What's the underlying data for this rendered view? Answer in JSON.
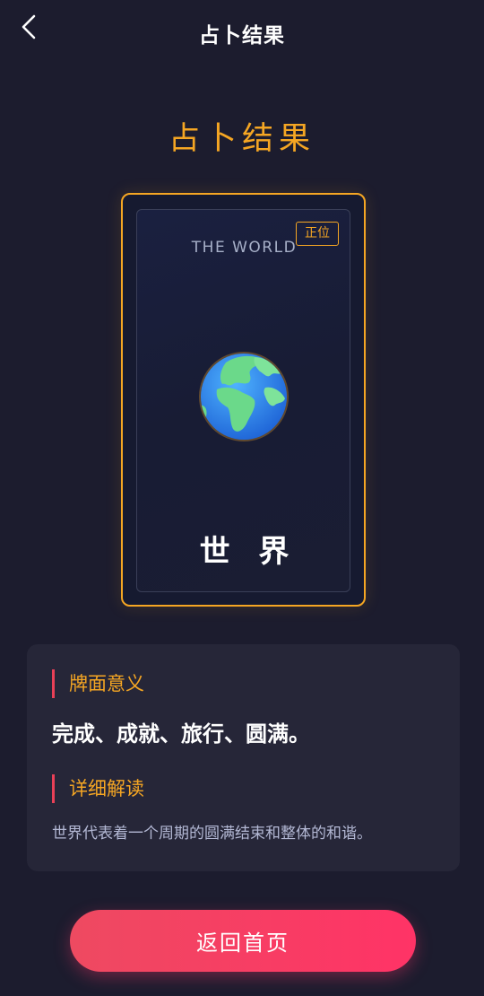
{
  "nav": {
    "title": "占卜结果",
    "back_icon": "chevron-left-icon"
  },
  "result": {
    "heading": "占卜结果"
  },
  "card": {
    "name_en": "THE WORLD",
    "name_cn": "世 界",
    "orientation": "正位",
    "image_icon": "globe-icon"
  },
  "interpretation": {
    "meaning_title": "牌面意义",
    "meaning_text": "完成、成就、旅行、圆满。",
    "detail_title": "详细解读",
    "detail_text": "世界代表着一个周期的圆满结束和整体的和谐。"
  },
  "actions": {
    "home_label": "返回首页"
  },
  "colors": {
    "background": "#1c1c2e",
    "accent_gold": "#f5a623",
    "accent_pink": "#ff3366",
    "panel": "#262638"
  }
}
